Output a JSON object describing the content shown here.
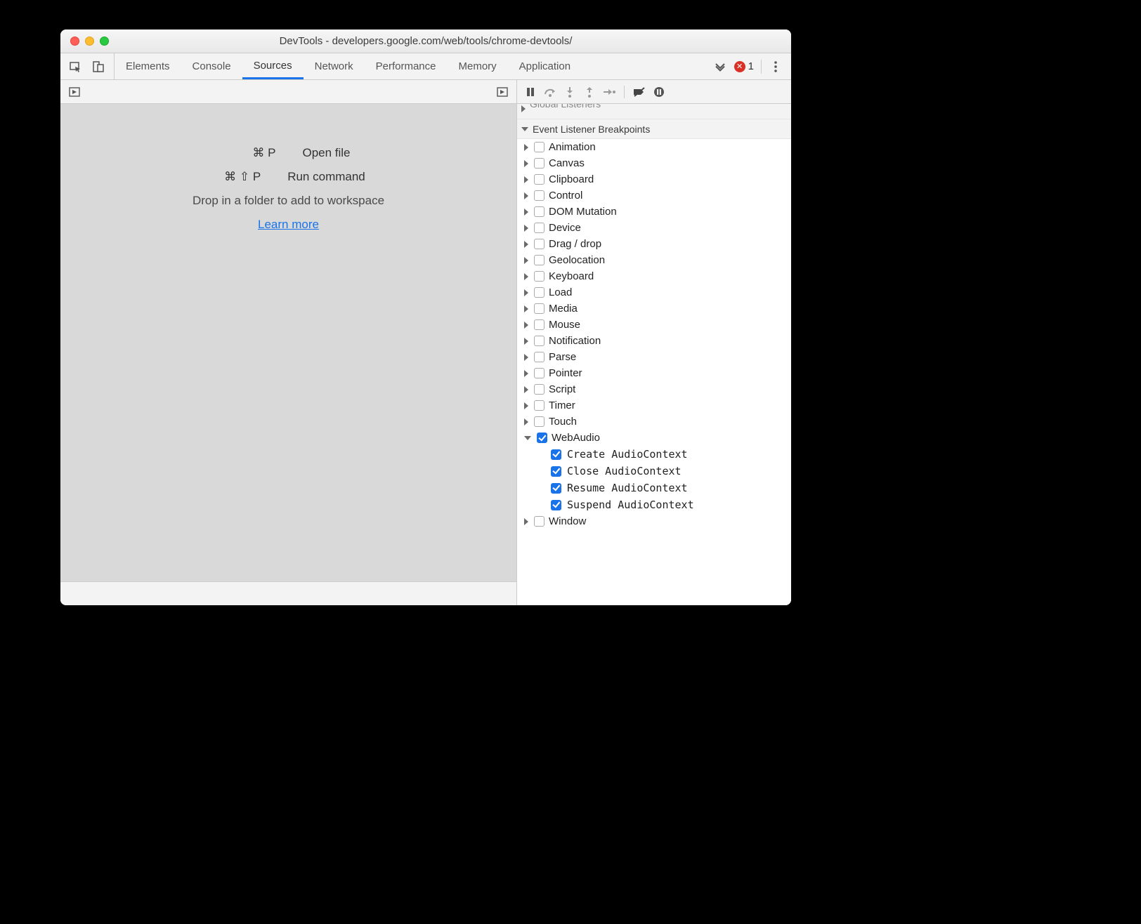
{
  "window": {
    "title": "DevTools - developers.google.com/web/tools/chrome-devtools/"
  },
  "tabs": {
    "items": [
      "Elements",
      "Console",
      "Sources",
      "Network",
      "Performance",
      "Memory",
      "Application"
    ],
    "active_index": 2,
    "error_count": "1"
  },
  "sources_hints": {
    "openfile_kbd": "⌘ P",
    "openfile_label": "Open file",
    "runcmd_kbd": "⌘ ⇧ P",
    "runcmd_label": "Run command",
    "drop_text": "Drop in a folder to add to workspace",
    "learn_more": "Learn more"
  },
  "sidebar": {
    "global_listeners": "Global Listeners",
    "breakpoints_title": "Event Listener Breakpoints",
    "categories": [
      {
        "label": "Animation",
        "checked": false,
        "expanded": false
      },
      {
        "label": "Canvas",
        "checked": false,
        "expanded": false
      },
      {
        "label": "Clipboard",
        "checked": false,
        "expanded": false
      },
      {
        "label": "Control",
        "checked": false,
        "expanded": false
      },
      {
        "label": "DOM Mutation",
        "checked": false,
        "expanded": false
      },
      {
        "label": "Device",
        "checked": false,
        "expanded": false
      },
      {
        "label": "Drag / drop",
        "checked": false,
        "expanded": false
      },
      {
        "label": "Geolocation",
        "checked": false,
        "expanded": false
      },
      {
        "label": "Keyboard",
        "checked": false,
        "expanded": false
      },
      {
        "label": "Load",
        "checked": false,
        "expanded": false
      },
      {
        "label": "Media",
        "checked": false,
        "expanded": false
      },
      {
        "label": "Mouse",
        "checked": false,
        "expanded": false
      },
      {
        "label": "Notification",
        "checked": false,
        "expanded": false
      },
      {
        "label": "Parse",
        "checked": false,
        "expanded": false
      },
      {
        "label": "Pointer",
        "checked": false,
        "expanded": false
      },
      {
        "label": "Script",
        "checked": false,
        "expanded": false
      },
      {
        "label": "Timer",
        "checked": false,
        "expanded": false
      },
      {
        "label": "Touch",
        "checked": false,
        "expanded": false
      },
      {
        "label": "WebAudio",
        "checked": true,
        "expanded": true,
        "children": [
          {
            "label": "Create AudioContext",
            "checked": true
          },
          {
            "label": "Close AudioContext",
            "checked": true
          },
          {
            "label": "Resume AudioContext",
            "checked": true
          },
          {
            "label": "Suspend AudioContext",
            "checked": true
          }
        ]
      },
      {
        "label": "Window",
        "checked": false,
        "expanded": false
      }
    ]
  }
}
